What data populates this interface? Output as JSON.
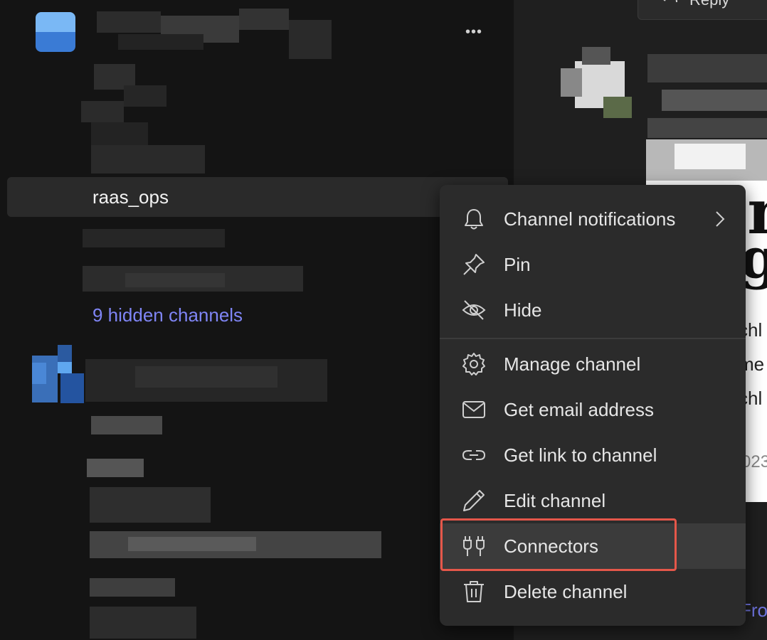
{
  "sidebar": {
    "more_label": "•••",
    "active_channel": "raas_ops",
    "hidden_channels_link": "9 hidden channels"
  },
  "main": {
    "reply_label": "Reply",
    "card_fragment_1": "Rzn",
    "card_fragment_2": "g",
    "card_lines": [
      "chl",
      "me",
      "chl"
    ],
    "card_date": "023",
    "from_link": "Fron"
  },
  "context_menu": {
    "items": [
      {
        "label": "Channel notifications",
        "icon": "bell-icon",
        "has_submenu": true
      },
      {
        "label": "Pin",
        "icon": "pin-icon"
      },
      {
        "label": "Hide",
        "icon": "eye-off-icon"
      },
      {
        "label": "Manage channel",
        "icon": "gear-icon"
      },
      {
        "label": "Get email address",
        "icon": "envelope-icon"
      },
      {
        "label": "Get link to channel",
        "icon": "link-icon"
      },
      {
        "label": "Edit channel",
        "icon": "pencil-icon"
      },
      {
        "label": "Connectors",
        "icon": "plug-icon",
        "hovered": true
      },
      {
        "label": "Delete channel",
        "icon": "trash-icon"
      }
    ]
  },
  "colors": {
    "highlight_border": "#e5574a",
    "link": "#7f85f5",
    "menu_bg": "#2b2b2b",
    "sidebar_bg": "#141414"
  }
}
